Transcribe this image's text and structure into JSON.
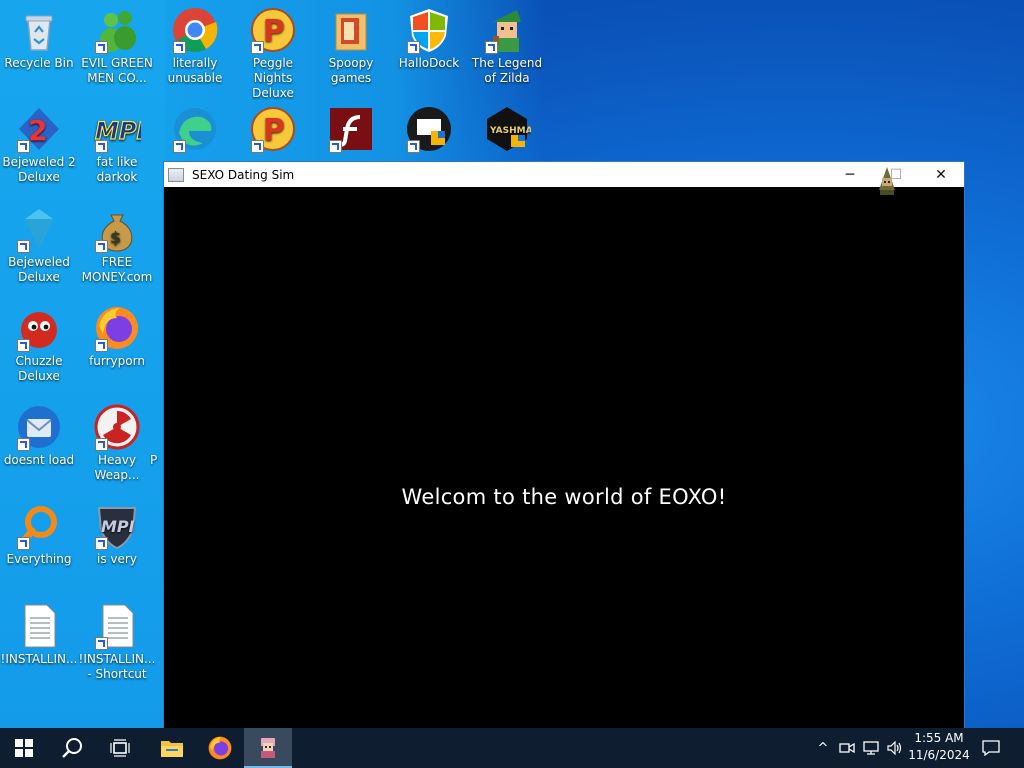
{
  "desktop": {
    "icons": [
      {
        "label": "Recycle Bin",
        "icon": "recycle-bin-icon"
      },
      {
        "label": "EVIL GREEN MEN CO...",
        "icon": "green-men-icon"
      },
      {
        "label": "literally unusable",
        "icon": "chrome-icon"
      },
      {
        "label": "Peggle Nights Deluxe",
        "icon": "peggle-icon"
      },
      {
        "label": "Spoopy games",
        "icon": "folder-icon"
      },
      {
        "label": "HalloDock",
        "icon": "windows-shield-icon"
      },
      {
        "label": "The Legend of Zilda",
        "icon": "zilda-icon"
      },
      {
        "label": "Bejeweled 2 Deluxe",
        "icon": "bejeweled-2-icon"
      },
      {
        "label": "fat like darkok",
        "icon": "mpi-icon"
      },
      {
        "label": "Bejeweled Deluxe",
        "icon": "gem-icon"
      },
      {
        "label": "FREE MONEY.com",
        "icon": "money-bag-icon"
      },
      {
        "label": "Chuzzle Deluxe",
        "icon": "chuzzle-icon"
      },
      {
        "label": "furryporn",
        "icon": "firefox-icon"
      },
      {
        "label": "doesnt load",
        "icon": "thunderbird-icon"
      },
      {
        "label": "Heavy Weap...",
        "icon": "radiation-icon"
      },
      {
        "label": "Everything",
        "icon": "magnifier-icon"
      },
      {
        "label": "is very",
        "icon": "mpi-shield-icon"
      },
      {
        "label": "!INSTALLIN...",
        "icon": "text-file-icon"
      },
      {
        "label": "!INSTALLIN... - Shortcut",
        "icon": "text-file-icon"
      },
      {
        "label": "",
        "icon": "edge-icon"
      },
      {
        "label": "",
        "icon": "peggle-icon"
      },
      {
        "label": "",
        "icon": "flash-icon"
      },
      {
        "label": "",
        "icon": "remote-desktop-icon"
      },
      {
        "label": "YASHMA",
        "icon": "yashma-icon"
      },
      {
        "label": "P",
        "icon": "partial-icon"
      }
    ]
  },
  "window": {
    "title": "SEXO Dating Sim",
    "minimize": "─",
    "maximize": "☐",
    "close": "✕",
    "message": "Welcom to the world of EOXO!"
  },
  "taskbar": {
    "start": "start-icon",
    "search": "search-icon",
    "task_view": "task-view-icon",
    "pinned": [
      "file-explorer-icon",
      "firefox-icon",
      "dating-sim-icon"
    ],
    "tray_chevron": "^",
    "time": "1:55 AM",
    "date": "11/6/2024"
  },
  "colors": {
    "desktop_left": "#15a0ec",
    "desktop_main": "#0f6ed6",
    "taskbar": "#0e1d2f",
    "window_bg": "#000000",
    "titlebar": "#ffffff"
  }
}
